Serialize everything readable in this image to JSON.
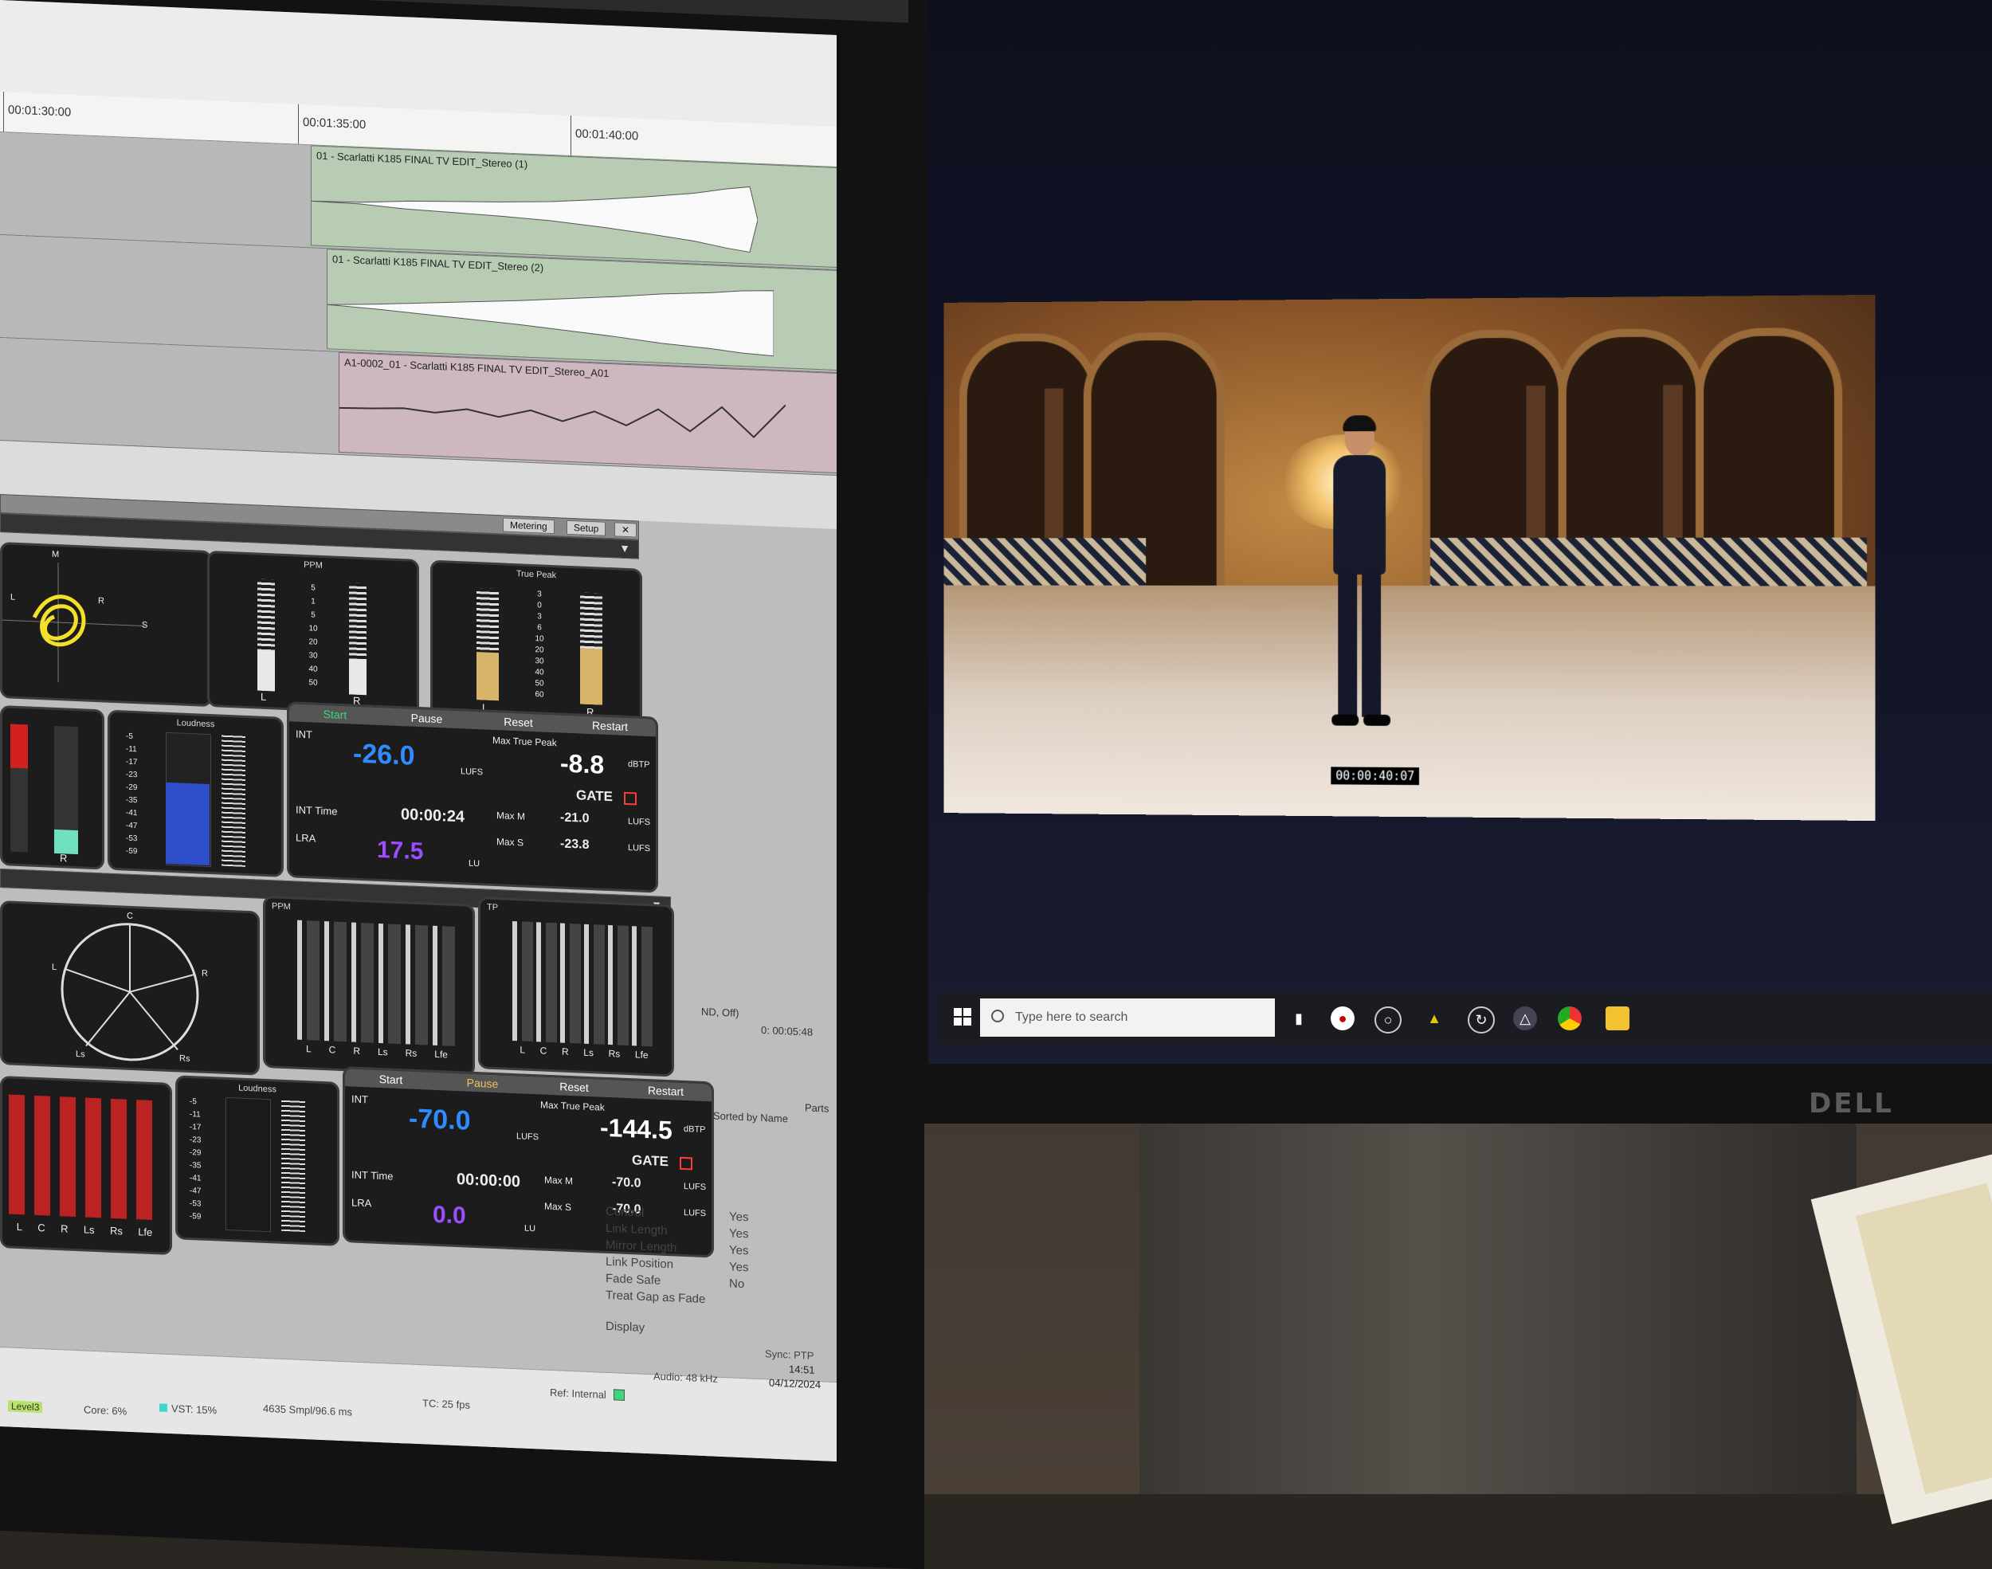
{
  "colors": {
    "meter_blue": "#2f8bff",
    "meter_purple": "#9b4dff",
    "accent_gate": "#ff3b3b",
    "start_green": "#3bd77c",
    "video_timecode_bg": "#000000"
  },
  "timeline": {
    "ruler": [
      "00:01:30:00",
      "00:01:35:00",
      "00:01:40:00"
    ],
    "clips": [
      "01 - Scarlatti K185 FINAL TV EDIT_Stereo (1)",
      "01 - Scarlatti K185 FINAL TV EDIT_Stereo (2)",
      "A1-0002_01 - Scarlatti K185 FINAL TV EDIT_Stereo_A01"
    ]
  },
  "meter_tabs": {
    "metering": "Metering",
    "setup": "Setup"
  },
  "stereo": {
    "ppm_title": "PPM",
    "tp_title": "True Peak",
    "loudness_title": "Loudness",
    "ppm_scale": [
      "5",
      "1",
      "5",
      "10",
      "20",
      "30",
      "40",
      "50"
    ],
    "tp_scale": [
      "3",
      "0",
      "3",
      "6",
      "10",
      "20",
      "30",
      "40",
      "50",
      "60"
    ],
    "loud_scale": [
      "-5",
      "-11",
      "-17",
      "-23",
      "-29",
      "-35",
      "-41",
      "-47",
      "-53",
      "-59"
    ],
    "controls": {
      "start": "Start",
      "pause": "Pause",
      "reset": "Reset",
      "restart": "Restart"
    },
    "int_label": "INT",
    "int_value": "-26.0",
    "lufs": "LUFS",
    "max_tp_label": "Max True Peak",
    "max_tp_value": "-8.8",
    "dbtp": "dBTP",
    "gate": "GATE",
    "int_time_label": "INT Time",
    "int_time": "00:00:24",
    "lra_label": "LRA",
    "lra_value": "17.5",
    "lu": "LU",
    "max_m_label": "Max M",
    "max_m": "-21.0",
    "max_s_label": "Max S",
    "max_s": "-23.8",
    "l": "L",
    "r": "R",
    "m": "M",
    "s": "S"
  },
  "surround": {
    "ppm_title": "PPM",
    "tp_title": "TP",
    "loudness_title": "Loudness",
    "channels": [
      "L",
      "C",
      "R",
      "Ls",
      "Rs",
      "Lfe"
    ],
    "controls": {
      "start": "Start",
      "pause": "Pause",
      "reset": "Reset",
      "restart": "Restart"
    },
    "int_label": "INT",
    "int_value": "-70.0",
    "lufs": "LUFS",
    "max_tp_label": "Max True Peak",
    "max_tp_value": "-144.5",
    "dbtp": "dBTP",
    "gate": "GATE",
    "int_time_label": "INT Time",
    "int_time": "00:00:00",
    "lra_label": "LRA",
    "lra_value": "0.0",
    "lu": "LU",
    "max_m_label": "Max M",
    "max_m": "-70.0",
    "max_s_label": "Max S",
    "max_s": "-70.0",
    "circle_labels": [
      "C",
      "L",
      "R",
      "Ls",
      "Rs"
    ]
  },
  "side_info": {
    "line1": "ND, Off)",
    "line2": "0: 00:05:48",
    "sorted": "Sorted by Name",
    "parts": "Parts"
  },
  "properties": [
    {
      "key": "Control",
      "value": "Yes"
    },
    {
      "key": "Link Length",
      "value": "Yes"
    },
    {
      "key": "Mirror Length",
      "value": "Yes"
    },
    {
      "key": "Link Position",
      "value": "Yes"
    },
    {
      "key": "Fade Safe",
      "value": "No"
    },
    {
      "key": "Treat Gap as Fade",
      "value": ""
    },
    {
      "key": "Display",
      "value": ""
    }
  ],
  "statusbar": {
    "sync": "Sync: PTP",
    "time": "14:51",
    "date": "04/12/2024",
    "audio": "Audio: 48 kHz",
    "ref": "Ref: Internal",
    "tc": "TC: 25 fps",
    "smpl": "4635 Smpl/96.6 ms",
    "vst": "VST: 15%",
    "core": "Core: 6%",
    "level": "Level3"
  },
  "video": {
    "timecode": "00:00:40:07"
  },
  "taskbar": {
    "search_placeholder": "Type here to search"
  },
  "brand": "DELL"
}
